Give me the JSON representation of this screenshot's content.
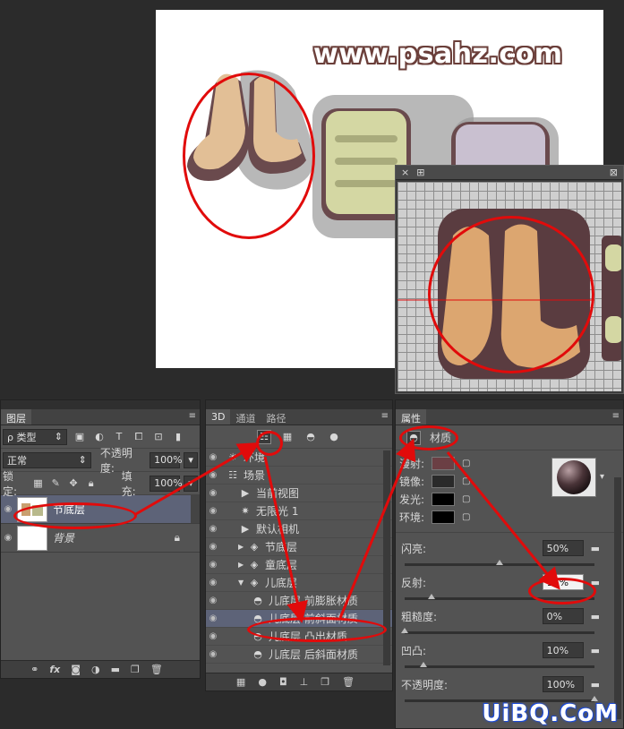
{
  "canvas": {
    "site_watermark": "www.psahz.com"
  },
  "subview": {
    "close_glyph": "×",
    "menu_glyph": "⊞"
  },
  "layers_panel": {
    "tab": "图层",
    "filter_kind": "ρ 类型",
    "blend_mode": "正常",
    "opacity_label": "不透明度:",
    "opacity_value": "100%",
    "lock_label": "锁定:",
    "fill_label": "填充:",
    "fill_value": "100%",
    "layers": [
      {
        "name": "节底层",
        "selected": true
      },
      {
        "name": "背景",
        "italic": true
      }
    ],
    "bottom_icons": [
      "link-icon",
      "fx",
      "mask-icon",
      "adjustment-icon",
      "folder-icon",
      "new-layer-icon",
      "trash-icon"
    ],
    "fx_label": "fx"
  },
  "scene_panel": {
    "tabs": [
      "3D",
      "通道",
      "路径"
    ],
    "items": [
      {
        "label": "环境",
        "indent": 0,
        "icon": "environment-icon"
      },
      {
        "label": "场景",
        "indent": 0,
        "icon": "scene-icon"
      },
      {
        "label": "当前视图",
        "indent": 1,
        "icon": "camera-icon"
      },
      {
        "label": "无限光 1",
        "indent": 1,
        "icon": "light-icon"
      },
      {
        "label": "默认相机",
        "indent": 1,
        "icon": "camera-icon"
      },
      {
        "label": "节底层",
        "indent": 1,
        "icon": "mesh-icon",
        "arrow": "▶"
      },
      {
        "label": "童底层",
        "indent": 1,
        "icon": "mesh-icon",
        "arrow": "▶"
      },
      {
        "label": "儿底层",
        "indent": 1,
        "icon": "mesh-icon",
        "arrow": "▼"
      },
      {
        "label": "儿底层 前膨胀材质",
        "indent": 2,
        "icon": "material-icon"
      },
      {
        "label": "儿底层 前斜面材质",
        "indent": 2,
        "icon": "material-icon",
        "selected": true
      },
      {
        "label": "儿底层 凸出材质",
        "indent": 2,
        "icon": "material-icon"
      },
      {
        "label": "儿底层 后斜面材质",
        "indent": 2,
        "icon": "material-icon"
      }
    ]
  },
  "properties_panel": {
    "tab": "属性",
    "section": "材质",
    "swatches": [
      {
        "label": "漫射:",
        "color": "#6b3f44"
      },
      {
        "label": "镜像:",
        "color": "#2a2a2a"
      },
      {
        "label": "发光:",
        "color": "#000000"
      },
      {
        "label": "环境:",
        "color": "#000000"
      }
    ],
    "sliders": [
      {
        "label": "闪亮:",
        "value": "50%",
        "fraction": 0.5,
        "editing": false
      },
      {
        "label": "反射:",
        "value": "14%",
        "fraction": 0.14,
        "editing": true
      },
      {
        "label": "粗糙度:",
        "value": "0%",
        "fraction": 0.0,
        "editing": false
      },
      {
        "label": "凹凸:",
        "value": "10%",
        "fraction": 0.1,
        "editing": false
      },
      {
        "label": "不透明度:",
        "value": "100%",
        "fraction": 1.0,
        "editing": false
      }
    ]
  },
  "colors": {
    "annotation_red": "#e10b0b",
    "selection_row": "#5d6378"
  },
  "bottom_watermark": "UiBQ.CoM"
}
